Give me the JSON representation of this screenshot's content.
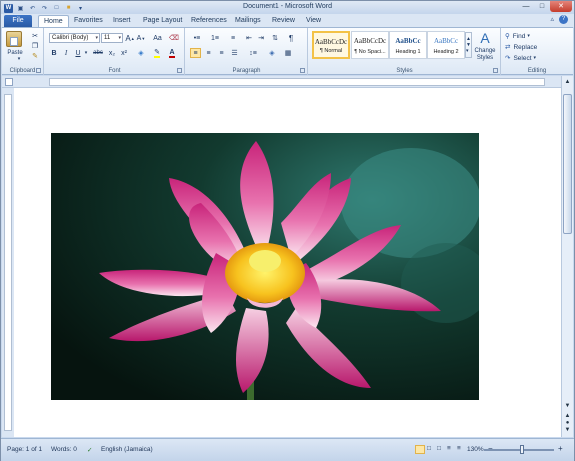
{
  "window": {
    "title": "Document1 - Microsoft Word"
  },
  "tabs": {
    "file": "File",
    "items": [
      "Home",
      "Favorites",
      "Insert",
      "Page Layout",
      "References",
      "Mailings",
      "Review",
      "View"
    ],
    "active": "Home"
  },
  "clipboard": {
    "paste_label": "Paste",
    "group_label": "Clipboard"
  },
  "font": {
    "font_name": "Calibri (Body)",
    "font_size": "11",
    "grow_label": "A",
    "shrink_label": "A",
    "case_label": "Aa",
    "bold": "B",
    "italic": "I",
    "underline": "U",
    "strikethrough": "abc",
    "subscript": "x₂",
    "superscript": "x²",
    "font_color_label": "A",
    "group_label": "Font"
  },
  "paragraph": {
    "group_label": "Paragraph",
    "pilcrow": "¶"
  },
  "styles": {
    "items": [
      {
        "sample": "AaBbCcDc",
        "name": "¶ Normal"
      },
      {
        "sample": "AaBbCcDc",
        "name": "¶ No Spaci..."
      },
      {
        "sample": "AaBbCc",
        "name": "Heading 1"
      },
      {
        "sample": "AaBbCc",
        "name": "Heading 2"
      }
    ],
    "selected_index": 0,
    "change_styles_line1": "Change",
    "change_styles_line2": "Styles",
    "group_label": "Styles"
  },
  "editing": {
    "find": "Find",
    "replace": "Replace",
    "select": "Select",
    "group_label": "Editing"
  },
  "status": {
    "page": "Page: 1 of 1",
    "words": "Words: 0",
    "language": "English (Jamaica)",
    "zoom": "130%",
    "zoom_level_percent": 130
  },
  "colors": {
    "file_tab": "#2a5aa5",
    "style_selected": "#f3c247",
    "font_color": "#c00000",
    "highlight": "#ffff00"
  },
  "icons": [
    "save-icon",
    "undo-icon",
    "redo-icon",
    "help-icon",
    "paste-icon",
    "cut-icon",
    "copy-icon",
    "format-painter-icon",
    "find-icon",
    "replace-icon",
    "select-icon",
    "change-styles-icon"
  ]
}
